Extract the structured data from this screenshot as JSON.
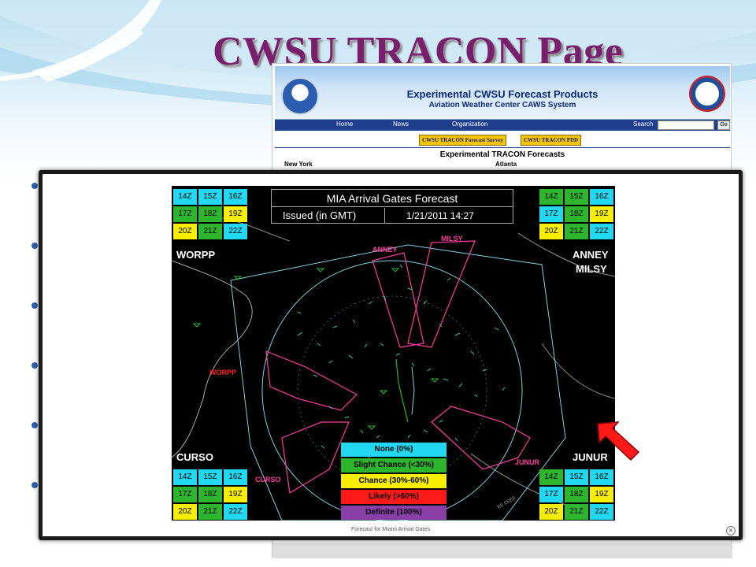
{
  "slide": {
    "title": "CWSU TRACON Page"
  },
  "website": {
    "title": "Experimental CWSU Forecast Products",
    "subtitle": "Aviation Weather Center CAWS System",
    "nav": [
      "Home",
      "News",
      "Organization",
      "Search"
    ],
    "search_go": "Go",
    "tabs": [
      "CWSU TRACON Forecast Survey",
      "CWSU TRACON PDD"
    ],
    "heading": "Experimental TRACON Forecasts",
    "columns": [
      "New York",
      "Atlanta"
    ]
  },
  "modal": {
    "caption": "Forecast for Miami Arrival Gates",
    "close_label": "×"
  },
  "forecast": {
    "title": "MIA Arrival Gates Forecast",
    "issued_label": "Issued  (in GMT)",
    "issued_time": "1/21/2011 14:27",
    "grids": {
      "worpp": [
        {
          "t": "14Z",
          "c": "cyan"
        },
        {
          "t": "15Z",
          "c": "cyan"
        },
        {
          "t": "16Z",
          "c": "cyan"
        },
        {
          "t": "17Z",
          "c": "green"
        },
        {
          "t": "18Z",
          "c": "green"
        },
        {
          "t": "19Z",
          "c": "yellow"
        },
        {
          "t": "20Z",
          "c": "yellow"
        },
        {
          "t": "21Z",
          "c": "green"
        },
        {
          "t": "22Z",
          "c": "cyan"
        }
      ],
      "anney": [
        {
          "t": "14Z",
          "c": "green"
        },
        {
          "t": "15Z",
          "c": "green"
        },
        {
          "t": "16Z",
          "c": "cyan"
        },
        {
          "t": "17Z",
          "c": "cyan"
        },
        {
          "t": "18Z",
          "c": "green"
        },
        {
          "t": "19Z",
          "c": "yellow"
        },
        {
          "t": "20Z",
          "c": "yellow"
        },
        {
          "t": "21Z",
          "c": "green"
        },
        {
          "t": "22Z",
          "c": "cyan"
        }
      ],
      "curso": [
        {
          "t": "14Z",
          "c": "cyan"
        },
        {
          "t": "15Z",
          "c": "cyan"
        },
        {
          "t": "16Z",
          "c": "cyan"
        },
        {
          "t": "17Z",
          "c": "green"
        },
        {
          "t": "18Z",
          "c": "green"
        },
        {
          "t": "19Z",
          "c": "yellow"
        },
        {
          "t": "20Z",
          "c": "yellow"
        },
        {
          "t": "21Z",
          "c": "green"
        },
        {
          "t": "22Z",
          "c": "cyan"
        }
      ],
      "junur": [
        {
          "t": "14Z",
          "c": "green"
        },
        {
          "t": "15Z",
          "c": "cyan"
        },
        {
          "t": "16Z",
          "c": "cyan"
        },
        {
          "t": "17Z",
          "c": "cyan"
        },
        {
          "t": "18Z",
          "c": "green"
        },
        {
          "t": "19Z",
          "c": "yellow"
        },
        {
          "t": "20Z",
          "c": "yellow"
        },
        {
          "t": "21Z",
          "c": "green"
        },
        {
          "t": "22Z",
          "c": "cyan"
        }
      ]
    },
    "gate_labels": {
      "worpp": "WORPP",
      "anney": "ANNEY",
      "milsy": "MILSY",
      "curso": "CURSO",
      "junur": "JUNUR"
    },
    "map_labels": {
      "anney": "ANNEY",
      "milsy": "MILSY",
      "worpp": "WORPP",
      "curso": "CURSO",
      "junur": "JUNUR"
    },
    "legend": [
      "None (0%)",
      "Slight Chance (<30%)",
      "Chance (30%-60%)",
      "Likely (>60%)",
      "Definite (100%)"
    ]
  },
  "colors": {
    "title": "#7a1f6e",
    "cell_cyan": "#22d8f0",
    "cell_green": "#2db52d",
    "cell_yellow": "#f8ee00",
    "arrow": "#ff1a1a"
  }
}
